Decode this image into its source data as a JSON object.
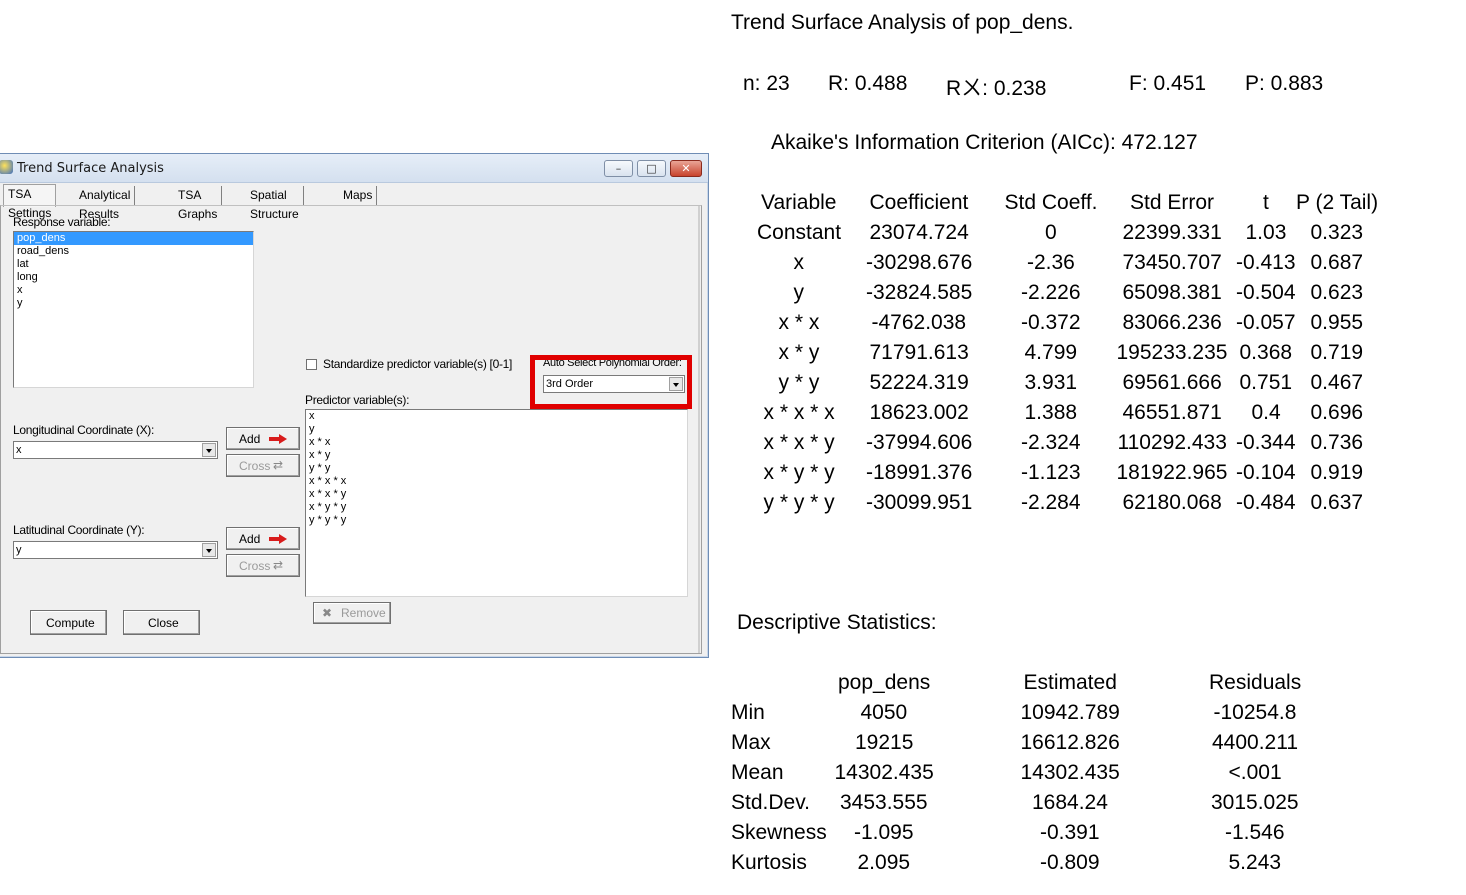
{
  "window": {
    "title": "Trend Surface Analysis",
    "tabs": [
      "TSA Settings",
      "Analytical Results",
      "TSA Graphs",
      "Spatial Structure",
      "Maps"
    ],
    "response_label": "Response variable:",
    "response_items": [
      "pop_dens",
      "road_dens",
      "lat",
      "long",
      "x",
      "y"
    ],
    "standardize_label": "Standardize predictor variable(s) [0-1]",
    "auto_select_label": "Auto Select Polynomial Order:",
    "auto_select_value": "3rd Order",
    "predictor_label": "Predictor variable(s):",
    "predictor_items": [
      "x",
      "y",
      "x * x",
      "x * y",
      "y * y",
      "x * x * x",
      "x * x * y",
      "x * y * y",
      "y * y * y"
    ],
    "long_label": "Longitudinal Coordinate (X):",
    "long_value": "x",
    "lat_label": "Latitudinal Coordinate (Y):",
    "lat_value": "y",
    "add_label": "Add",
    "cross_label": "Cross",
    "remove_label": "Remove",
    "compute_label": "Compute",
    "close_label": "Close"
  },
  "output": {
    "title": "Trend Surface Analysis of pop_dens.",
    "stats": {
      "n": "n: 23",
      "r": "R: 0.488",
      "r2": "Rㄨ: 0.238",
      "f": "F: 0.451",
      "p": "P: 0.883"
    },
    "aicc": "Akaike's Information Criterion (AICc): 472.127",
    "coef_headers": [
      "Variable",
      "Coefficient",
      "Std Coeff.",
      "Std Error",
      "t",
      "P (2 Tail)"
    ],
    "coef_rows": [
      [
        "Constant",
        "23074.724",
        "0",
        "22399.331",
        "1.03",
        "0.323"
      ],
      [
        "x",
        "-30298.676",
        "-2.36",
        "73450.707",
        "-0.413",
        "0.687"
      ],
      [
        "y",
        "-32824.585",
        "-2.226",
        "65098.381",
        "-0.504",
        "0.623"
      ],
      [
        "x * x",
        "-4762.038",
        "-0.372",
        "83066.236",
        "-0.057",
        "0.955"
      ],
      [
        "x * y",
        "71791.613",
        "4.799",
        "195233.235",
        "0.368",
        "0.719"
      ],
      [
        "y * y",
        "52224.319",
        "3.931",
        "69561.666",
        "0.751",
        "0.467"
      ],
      [
        "x * x * x",
        "18623.002",
        "1.388",
        "46551.871",
        "0.4",
        "0.696"
      ],
      [
        "x * x * y",
        "-37994.606",
        "-2.324",
        "110292.433",
        "-0.344",
        "0.736"
      ],
      [
        "x * y * y",
        "-18991.376",
        "-1.123",
        "181922.965",
        "-0.104",
        "0.919"
      ],
      [
        "y * y * y",
        "-30099.951",
        "-2.284",
        "62180.068",
        "-0.484",
        "0.637"
      ]
    ],
    "desc_title": "Descriptive Statistics:",
    "desc_headers": [
      "pop_dens",
      "Estimated",
      "Residuals"
    ],
    "desc_rows": [
      [
        "Min",
        "4050",
        "10942.789",
        "-10254.8"
      ],
      [
        "Max",
        "19215",
        "16612.826",
        "4400.211"
      ],
      [
        "Mean",
        "14302.435",
        "14302.435",
        "<.001"
      ],
      [
        "Std.Dev.",
        "3453.555",
        "1684.24",
        "3015.025"
      ],
      [
        "Skewness",
        "-1.095",
        "-0.391",
        "-1.546"
      ],
      [
        "Kurtosis",
        "2.095",
        "-0.809",
        "5.243"
      ]
    ]
  }
}
